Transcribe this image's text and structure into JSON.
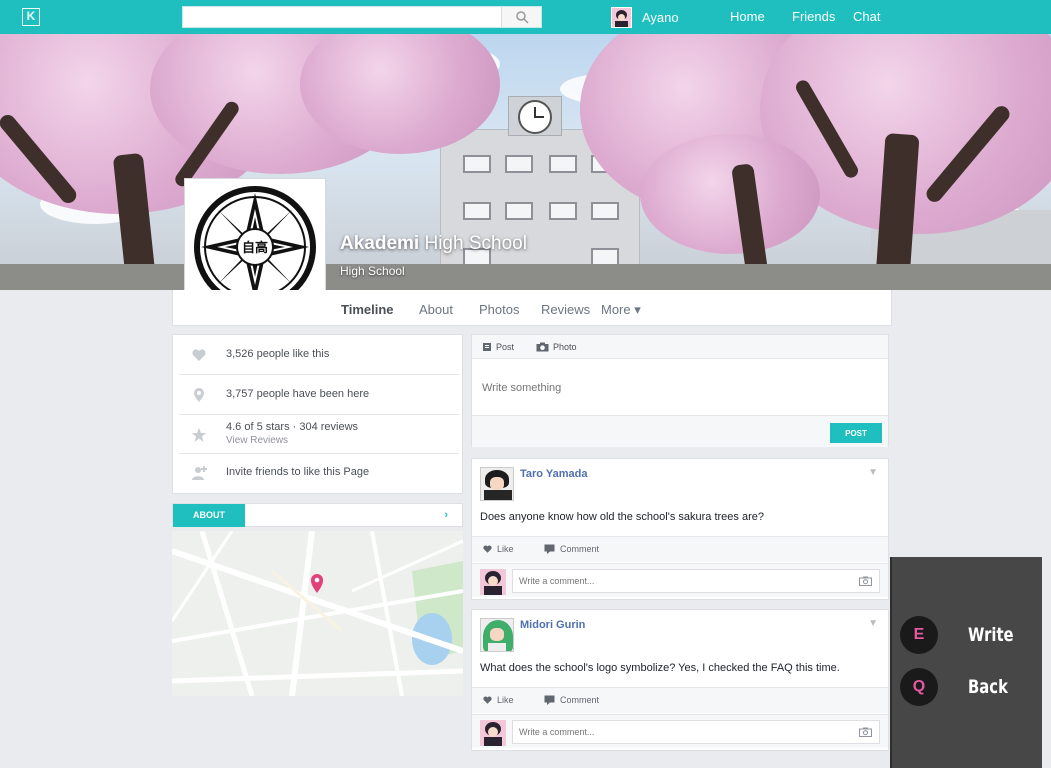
{
  "app": {
    "logo_letter": "K"
  },
  "search": {
    "placeholder": ""
  },
  "user": {
    "name": "Ayano"
  },
  "nav": {
    "home": "Home",
    "friends": "Friends",
    "chat": "Chat"
  },
  "page": {
    "title_bold": "Akademi",
    "title_rest": " High School",
    "category": "High School",
    "logo_text": "自高"
  },
  "tabs": [
    {
      "label": "Timeline",
      "active": true
    },
    {
      "label": "About"
    },
    {
      "label": "Photos"
    },
    {
      "label": "Reviews"
    },
    {
      "label": "More ▾"
    }
  ],
  "stats": {
    "likes": "3,526 people like this",
    "visits": "3,757 people have been here",
    "rating": "4.6 of 5 stars · 304 reviews",
    "view_reviews": "View Reviews",
    "invite": "Invite friends to like this Page"
  },
  "about": {
    "tab_label": "ABOUT",
    "arrow": "›"
  },
  "composer": {
    "post_tab": "Post",
    "photo_tab": "Photo",
    "placeholder": "Write something",
    "post_button": "POST"
  },
  "posts": [
    {
      "author": "Taro Yamada",
      "message": "Does anyone know how old the school's sakura trees are?",
      "like": "Like",
      "comment": "Comment",
      "comment_placeholder": "Write a comment..."
    },
    {
      "author": "Midori Gurin",
      "message": "What does the school's logo symbolize? Yes, I checked the FAQ this time.",
      "like": "Like",
      "comment": "Comment",
      "comment_placeholder": "Write a comment..."
    }
  ],
  "controls": [
    {
      "key": "E",
      "label": "Write"
    },
    {
      "key": "Q",
      "label": "Back"
    }
  ],
  "colors": {
    "accent": "#1fbfbf",
    "key_text": "#e65aa4",
    "author": "#4f6fb0"
  }
}
